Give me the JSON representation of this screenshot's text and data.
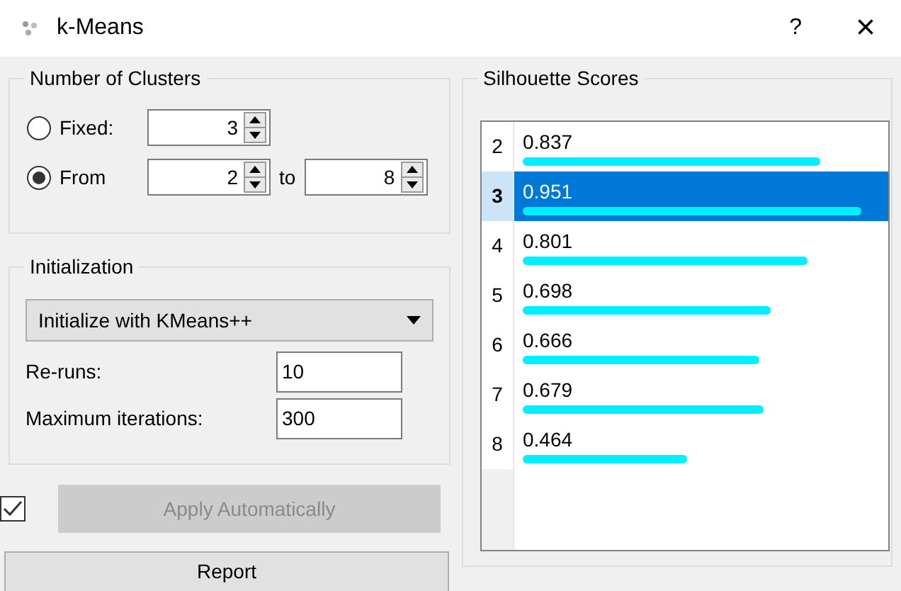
{
  "window": {
    "title": "k-Means",
    "help": "?",
    "close": "×"
  },
  "clusters": {
    "title": "Number of Clusters",
    "options": [
      {
        "label": "Fixed:",
        "selected": false,
        "from": "3"
      },
      {
        "label": "From",
        "selected": true,
        "from": "2",
        "joiner": "to",
        "to": "8"
      }
    ]
  },
  "initialization": {
    "title": "Initialization",
    "method": "Initialize with KMeans++",
    "reruns_label": "Re-runs:",
    "reruns": "10",
    "iterations_label": "Maximum iterations:",
    "iterations": "300"
  },
  "apply": {
    "checked": true,
    "label": "Apply Automatically",
    "disabled": true
  },
  "report": "Report",
  "scores": {
    "title": "Silhouette Scores",
    "rows": [
      {
        "k": "2",
        "score": "0.837",
        "level": 0.837,
        "selected": false
      },
      {
        "k": "3",
        "score": "0.951",
        "level": 0.951,
        "selected": true
      },
      {
        "k": "4",
        "score": "0.801",
        "level": 0.801,
        "selected": false
      },
      {
        "k": "5",
        "score": "0.698",
        "level": 0.698,
        "selected": false
      },
      {
        "k": "6",
        "score": "0.666",
        "level": 0.666,
        "selected": false
      },
      {
        "k": "7",
        "score": "0.679",
        "level": 0.679,
        "selected": false
      },
      {
        "k": "8",
        "score": "0.464",
        "level": 0.464,
        "selected": false
      }
    ]
  }
}
